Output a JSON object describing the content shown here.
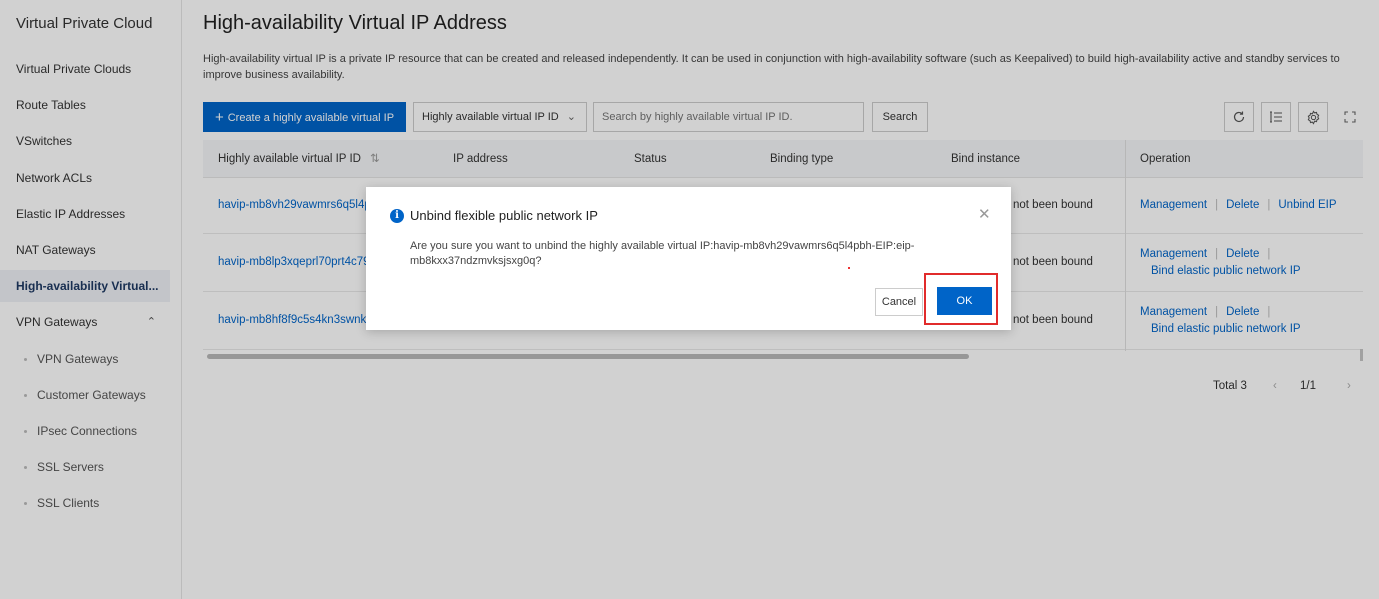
{
  "sidebar": {
    "title": "Virtual Private Cloud",
    "items": [
      {
        "label": "Virtual Private Clouds"
      },
      {
        "label": "Route Tables"
      },
      {
        "label": "VSwitches"
      },
      {
        "label": "Network ACLs"
      },
      {
        "label": "Elastic IP Addresses"
      },
      {
        "label": "NAT Gateways"
      },
      {
        "label": "High-availability Virtual..."
      },
      {
        "label": "VPN Gateways"
      }
    ],
    "vpn_children": [
      {
        "label": "VPN Gateways"
      },
      {
        "label": "Customer Gateways"
      },
      {
        "label": "IPsec Connections"
      },
      {
        "label": "SSL Servers"
      },
      {
        "label": "SSL Clients"
      }
    ]
  },
  "page": {
    "title": "High-availability Virtual IP Address",
    "description": "High-availability virtual IP is a private IP resource that can be created and released independently. It can be used in conjunction with high-availability software (such as Keepalived) to build high-availability active and standby services to improve business availability."
  },
  "toolbar": {
    "create_label": "Create a highly available virtual IP",
    "filter_select_value": "Highly available virtual IP ID",
    "search_placeholder": "Search by highly available virtual IP ID.",
    "search_label": "Search"
  },
  "table": {
    "columns": [
      "Highly available virtual IP ID",
      "IP address",
      "Status",
      "Binding type",
      "Bind instance",
      "Operation"
    ],
    "rows": [
      {
        "id": "havip-mb8vh29vawmrs6q5l4pb",
        "bind_instance": "not been bound",
        "ops": [
          "Management",
          "Delete",
          "Unbind EIP"
        ],
        "op2": ""
      },
      {
        "id": "havip-mb8lp3xqeprl70prt4c79",
        "bind_instance": "not been bound",
        "ops": [
          "Management",
          "Delete"
        ],
        "op2": "Bind elastic public network IP"
      },
      {
        "id": "havip-mb8hf8f9c5s4kn3swnki1",
        "bind_instance": "not been bound",
        "ops": [
          "Management",
          "Delete"
        ],
        "op2": "Bind elastic public network IP"
      }
    ]
  },
  "pagination": {
    "total": "Total 3",
    "page": "1/1"
  },
  "dialog": {
    "title": "Unbind flexible public network IP",
    "body_line1": "Are you sure you want to unbind the highly available virtual IP:havip-mb8vh29vawmrs6q5l4pbh-EIP:eip-",
    "body_line2": "mb8kxx37ndzmvksjsxg0q?",
    "cancel_label": "Cancel",
    "ok_label": "OK"
  },
  "colors": {
    "primary": "#0064c8",
    "highlight": "#e12b2b"
  }
}
